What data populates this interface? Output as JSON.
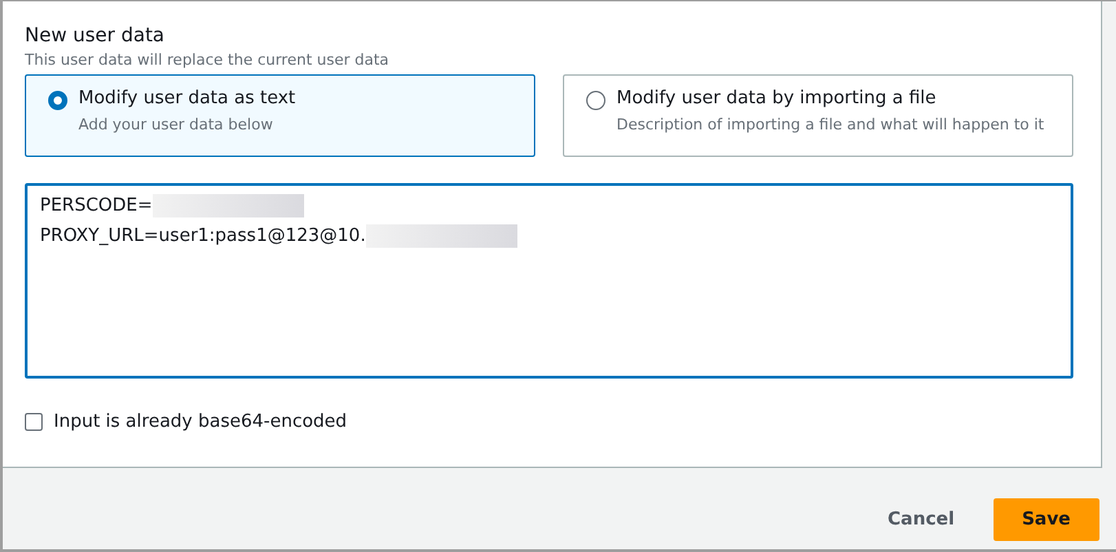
{
  "section": {
    "title": "New user data",
    "description": "This user data will replace the current user data"
  },
  "options": [
    {
      "label": "Modify user data as text",
      "description": "Add your user data below",
      "selected": true
    },
    {
      "label": "Modify user data by importing a file",
      "description": "Description of importing a file and what will happen to it",
      "selected": false
    }
  ],
  "editor": {
    "lines": [
      {
        "text": "PERSCODE="
      },
      {
        "text": "PROXY_URL=user1:pass1@123@10."
      }
    ]
  },
  "base64_checkbox": {
    "label": "Input is already base64-encoded",
    "checked": false
  },
  "buttons": [
    {
      "label": "Cancel",
      "kind": "link"
    },
    {
      "label": "Save",
      "kind": "primary"
    }
  ]
}
